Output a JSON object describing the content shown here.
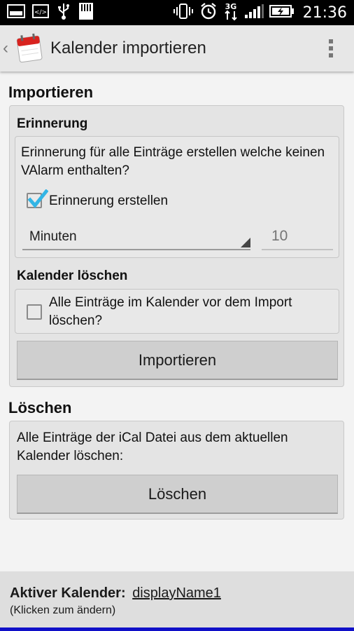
{
  "status_bar": {
    "time": "21:36",
    "network": "3G",
    "icons": [
      "gallery-icon",
      "code-icon",
      "usb-icon",
      "sd-card-icon",
      "vibrate-icon",
      "alarm-icon",
      "network-3g-icon",
      "signal-icon",
      "battery-charging-icon"
    ]
  },
  "action_bar": {
    "title": "Kalender importieren",
    "icons": [
      "back-chevron-icon",
      "calendar-app-icon",
      "overflow-menu-icon"
    ]
  },
  "import_section": {
    "title": "Importieren",
    "reminder": {
      "title": "Erinnerung",
      "description": "Erinnerung für alle Einträge erstellen welche keinen VAlarm enthalten?",
      "checkbox_label": "Erinnerung erstellen",
      "checkbox_checked": true,
      "unit_selected": "Minuten",
      "amount_placeholder": "10"
    },
    "delete_calendar": {
      "title": "Kalender löschen",
      "checkbox_label": "Alle Einträge im Kalender vor dem Import löschen?",
      "checkbox_checked": false
    },
    "import_button": "Importieren"
  },
  "delete_section": {
    "title": "Löschen",
    "description": "Alle Einträge der iCal Datei aus dem aktuellen Kalender löschen:",
    "delete_button": "Löschen"
  },
  "footer": {
    "label": "Aktiver Kalender:",
    "calendar_name": "displayName1",
    "hint": "(Klicken zum ändern)"
  },
  "colors": {
    "accent_check": "#33b5e5",
    "bottom_strip": "#1010c8",
    "status_bar": "#000000",
    "action_bar": "#e7e7e7"
  }
}
